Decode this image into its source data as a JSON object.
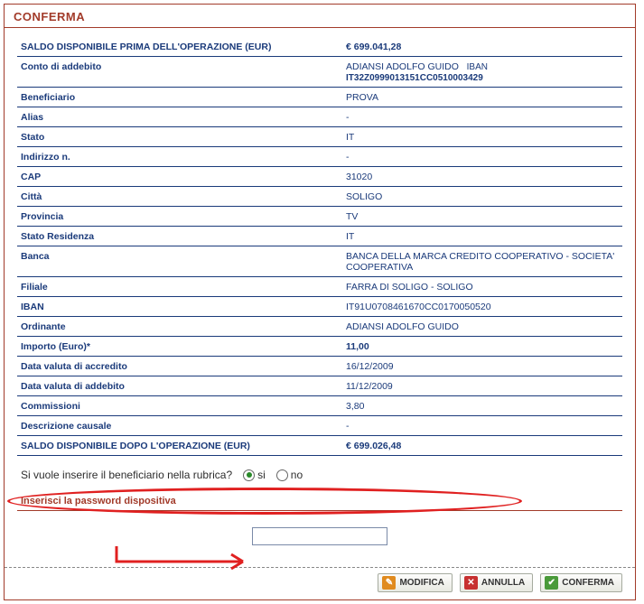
{
  "page": {
    "title": "CONFERMA"
  },
  "rows": [
    {
      "label": "SALDO DISPONIBILE PRIMA DELL'OPERAZIONE (EUR)",
      "value": "€ 699.041,28",
      "bold": true
    },
    {
      "label": "Conto di addebito",
      "value_name": "ADIANSI ADOLFO GUIDO",
      "value_iban_label": "IBAN",
      "value_iban": "IT32Z0999013151CC0510003429"
    },
    {
      "label": "Beneficiario",
      "value": "PROVA"
    },
    {
      "label": "Alias",
      "value": "-"
    },
    {
      "label": "Stato",
      "value": "IT"
    },
    {
      "label": "Indirizzo n.",
      "value": "-"
    },
    {
      "label": "CAP",
      "value": "31020"
    },
    {
      "label": "Città",
      "value": "SOLIGO"
    },
    {
      "label": "Provincia",
      "value": "TV"
    },
    {
      "label": "Stato Residenza",
      "value": "IT"
    },
    {
      "label": "Banca",
      "value": "BANCA DELLA MARCA CREDITO COOPERATIVO - SOCIETA' COOPERATIVA"
    },
    {
      "label": "Filiale",
      "value": "FARRA DI SOLIGO - SOLIGO"
    },
    {
      "label": "IBAN",
      "value": "IT91U0708461670CC0170050520"
    },
    {
      "label": "Ordinante",
      "value": "ADIANSI ADOLFO GUIDO"
    },
    {
      "label": "Importo (Euro)*",
      "value": "11,00",
      "bold": true
    },
    {
      "label": "Data valuta di accredito",
      "value": "16/12/2009"
    },
    {
      "label": "Data valuta di addebito",
      "value": "11/12/2009"
    },
    {
      "label": "Commissioni",
      "value": "3,80"
    },
    {
      "label": "Descrizione causale",
      "value": "-"
    },
    {
      "label": "SALDO DISPONIBILE DOPO L'OPERAZIONE (EUR)",
      "value": "€ 699.026,48",
      "bold": true
    }
  ],
  "question": {
    "text": "Si vuole inserire il beneficiario nella rubrica?",
    "option_yes": "si",
    "option_no": "no",
    "selected": "si"
  },
  "password": {
    "label": "Inserisci la password dispositiva",
    "value": ""
  },
  "buttons": {
    "modify": "MODIFICA",
    "cancel": "ANNULLA",
    "confirm": "CONFERMA"
  }
}
